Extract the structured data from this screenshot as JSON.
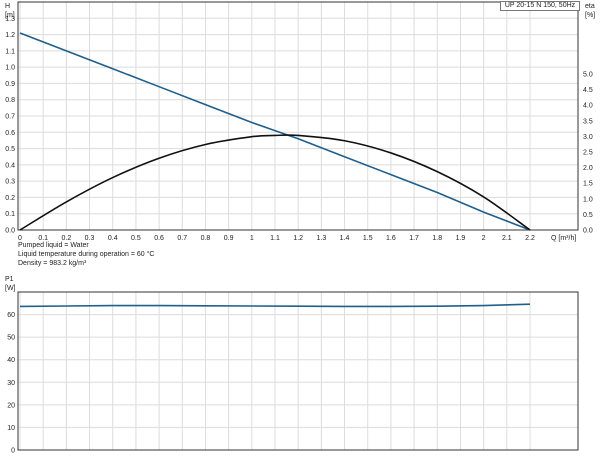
{
  "chart_data": [
    {
      "type": "line",
      "title": "UP 20-15 N 150, 50Hz",
      "xlabel": "Q [m³/h]",
      "ylabel_left": "H [m]",
      "ylabel_right": "eta [%]",
      "xlim": [
        0,
        2.2
      ],
      "ylim_left": [
        0,
        1.4
      ],
      "ylim_right": [
        0,
        5.0
      ],
      "xticks": [
        "0",
        "0.1",
        "0.2",
        "0.3",
        "0.4",
        "0.5",
        "0.6",
        "0.7",
        "0.8",
        "0.9",
        "1",
        "1.1",
        "1.2",
        "1.3",
        "1.4",
        "1.5",
        "1.6",
        "1.7",
        "1.8",
        "1.9",
        "2",
        "2.1",
        "2.2"
      ],
      "yticks_left": [
        "0.0",
        "0.1",
        "0.2",
        "0.3",
        "0.4",
        "0.5",
        "0.6",
        "0.7",
        "0.8",
        "0.9",
        "1.0",
        "1.1",
        "1.2",
        "1.3"
      ],
      "yticks_right": [
        "0.0",
        "0.5",
        "1.0",
        "1.5",
        "2.0",
        "2.5",
        "3.0",
        "3.5",
        "4.0",
        "4.5",
        "5.0"
      ],
      "grid": true,
      "series": [
        {
          "axis": "left",
          "color": "#1f5f8b",
          "x": [
            0,
            0.2,
            0.4,
            0.6,
            0.8,
            1.0,
            1.2,
            1.4,
            1.6,
            1.8,
            2.0,
            2.2
          ],
          "y": [
            1.21,
            1.1,
            0.99,
            0.88,
            0.77,
            0.66,
            0.56,
            0.45,
            0.34,
            0.23,
            0.11,
            0.0
          ]
        },
        {
          "axis": "right",
          "color": "#111111",
          "x": [
            0,
            0.2,
            0.4,
            0.6,
            0.8,
            1.0,
            1.1,
            1.2,
            1.4,
            1.6,
            1.8,
            2.0,
            2.2
          ],
          "y": [
            0.0,
            0.9,
            1.68,
            2.3,
            2.74,
            2.99,
            3.03,
            3.03,
            2.86,
            2.47,
            1.87,
            1.06,
            0.0
          ]
        }
      ]
    },
    {
      "type": "line",
      "ylabel": "P1 [W]",
      "xlim": [
        0,
        2.2
      ],
      "ylim": [
        0,
        70
      ],
      "yticks": [
        "0",
        "10",
        "20",
        "30",
        "40",
        "50",
        "60"
      ],
      "grid": true,
      "series": [
        {
          "color": "#1f5f8b",
          "x": [
            0,
            0.2,
            0.4,
            0.6,
            0.8,
            1.0,
            1.2,
            1.4,
            1.6,
            1.8,
            2.0,
            2.2
          ],
          "y": [
            63.6,
            63.8,
            64.0,
            64.0,
            63.9,
            63.8,
            63.7,
            63.6,
            63.6,
            63.7,
            64.0,
            64.6
          ]
        }
      ]
    }
  ],
  "notes": {
    "liquid": "Pumped liquid = Water",
    "temperature": "Liquid temperature during operation = 60 °C",
    "density": "Density = 983.2 kg/m³"
  }
}
